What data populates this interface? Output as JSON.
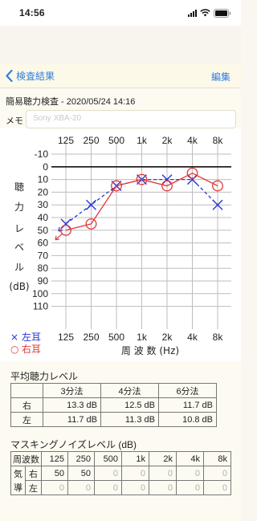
{
  "status": {
    "time": "14:56"
  },
  "nav": {
    "back_label": "検査結果",
    "edit_label": "編集"
  },
  "test": {
    "title": "簡易聴力検査 - 2020/05/24 14:16"
  },
  "memo": {
    "label": "メモ",
    "value": "Sony XBA-20"
  },
  "chart_data": {
    "type": "line",
    "title": "",
    "frequencies": [
      "125",
      "250",
      "500",
      "1k",
      "2k",
      "4k",
      "8k"
    ],
    "y_ticks": [
      "-10",
      "0",
      "10",
      "20",
      "30",
      "40",
      "50",
      "60",
      "70",
      "80",
      "90",
      "100",
      "110"
    ],
    "ylim": [
      -10,
      110
    ],
    "y_inverted": true,
    "y_label_chars": [
      "聴",
      "力",
      "レ",
      "ベ",
      "ル",
      "(dB)"
    ],
    "x_label": "周 波 数 (Hz)",
    "grid": true,
    "legend": [
      {
        "symbol": "×",
        "label": "左耳",
        "color": "#2a35d8"
      },
      {
        "symbol": "○",
        "label": "右耳",
        "color": "#e03a3a"
      }
    ],
    "series": [
      {
        "name": "左耳",
        "color": "#2a35d8",
        "marker": "x",
        "dashed": true,
        "values": [
          45,
          30,
          15,
          10,
          10,
          10,
          30
        ],
        "out_of_range_arrow": 0
      },
      {
        "name": "右耳",
        "color": "#e03a3a",
        "marker": "o",
        "dashed": false,
        "values": [
          50,
          45,
          15,
          10,
          15,
          5,
          15
        ],
        "out_of_range_arrow": 0
      }
    ]
  },
  "average": {
    "title": "平均聴力レベル",
    "headers": [
      "3分法",
      "4分法",
      "6分法"
    ],
    "rows": [
      {
        "label": "右",
        "values": [
          "13.3 dB",
          "12.5 dB",
          "11.7 dB"
        ]
      },
      {
        "label": "左",
        "values": [
          "11.7 dB",
          "11.3 dB",
          "10.8 dB"
        ]
      }
    ]
  },
  "masking": {
    "title": "マスキングノイズレベル (dB)",
    "header_label": "周波数",
    "frequencies": [
      "125",
      "250",
      "500",
      "1k",
      "2k",
      "4k",
      "8k"
    ],
    "row_group_label_1": "気",
    "row_group_label_2": "導",
    "rows": [
      {
        "label": "右",
        "values": [
          "50",
          "50",
          "0",
          "0",
          "0",
          "0",
          "0"
        ]
      },
      {
        "label": "左",
        "values": [
          "0",
          "0",
          "0",
          "0",
          "0",
          "0",
          "0"
        ]
      }
    ]
  }
}
